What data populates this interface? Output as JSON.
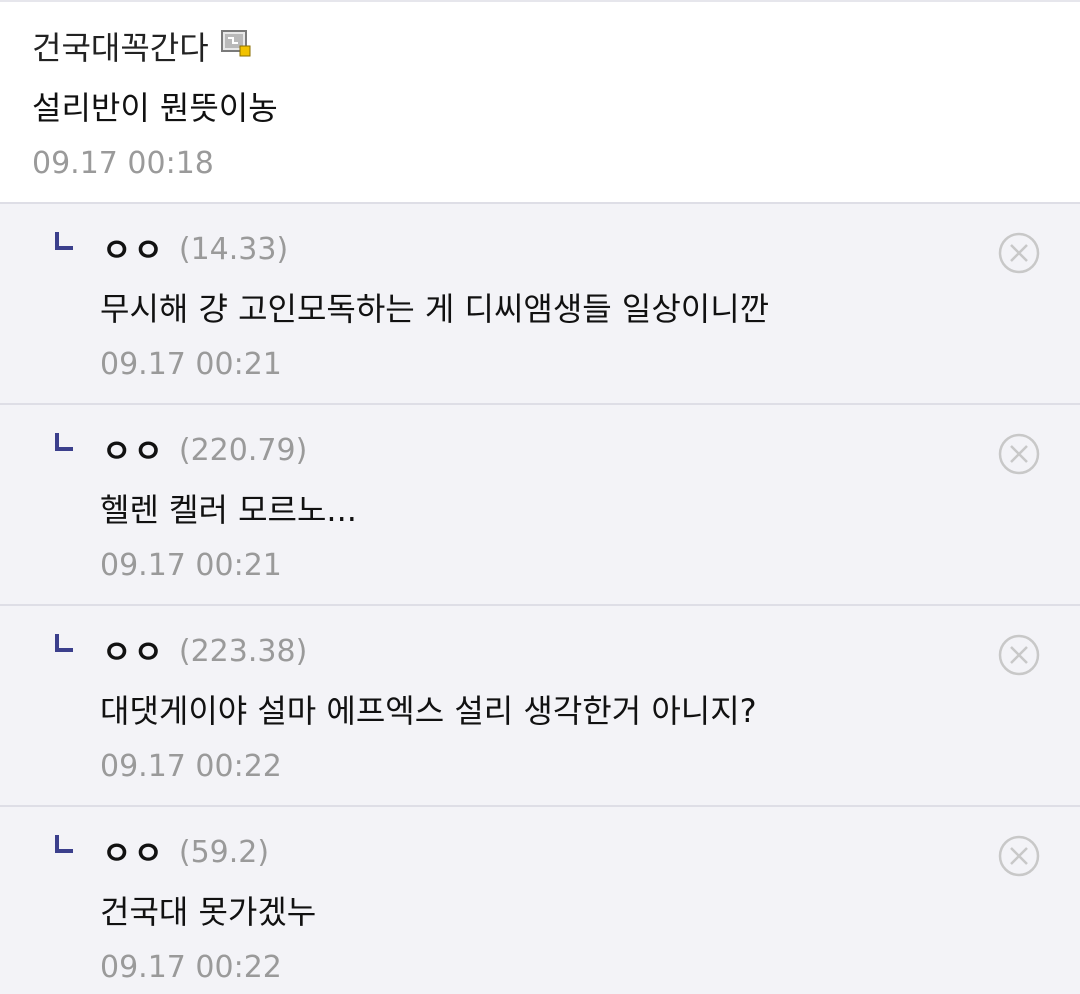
{
  "main_comment": {
    "author": "건국대꼭간다",
    "author_badge_icon": "gonik-user-icon",
    "body": "설리반이 뭔뜻이농",
    "timestamp": "09.17 00:18"
  },
  "replies": [
    {
      "nickname": "ㅇㅇ",
      "ip": "(14.33)",
      "body": "무시해 걍 고인모독하는 게 디씨앰생들 일상이니깐",
      "timestamp": "09.17 00:21"
    },
    {
      "nickname": "ㅇㅇ",
      "ip": "(220.79)",
      "body": "헬렌 켈러 모르노...",
      "timestamp": "09.17 00:21"
    },
    {
      "nickname": "ㅇㅇ",
      "ip": "(223.38)",
      "body": "대댓게이야 설마 에프엑스 설리 생각한거 아니지?",
      "timestamp": "09.17 00:22"
    },
    {
      "nickname": "ㅇㅇ",
      "ip": "(59.2)",
      "body": "건국대 못가겠누",
      "timestamp": "09.17 00:22"
    }
  ],
  "colors": {
    "reply_background": "#f3f3f7",
    "reply_arrow": "#3b3f8c",
    "meta_gray": "#9a9a9a",
    "delete_icon": "#c8c8c8"
  }
}
